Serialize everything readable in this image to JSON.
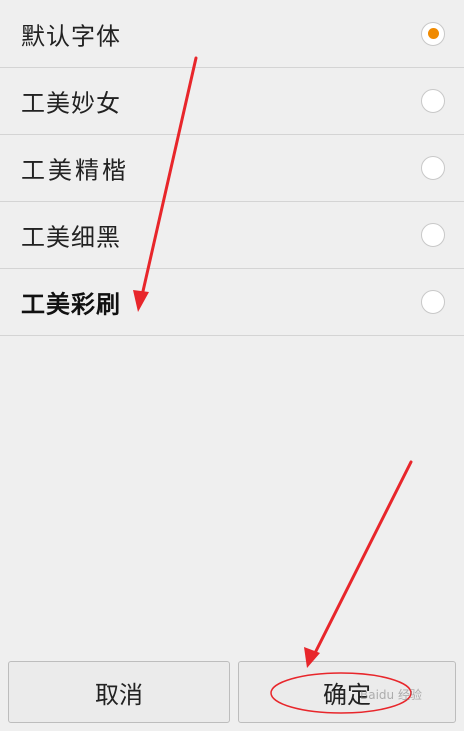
{
  "font_options": [
    {
      "label": "默认字体",
      "selected": true
    },
    {
      "label": "工美妙女",
      "selected": false
    },
    {
      "label": "工美精楷",
      "selected": false
    },
    {
      "label": "工美细黑",
      "selected": false
    },
    {
      "label": "工美彩刷",
      "selected": false
    }
  ],
  "buttons": {
    "cancel_label": "取消",
    "confirm_label": "确定"
  },
  "watermark": "Baidu 经验",
  "colors": {
    "background": "#efefef",
    "radio_selected": "#f08a00",
    "annotation": "#e8262b"
  }
}
